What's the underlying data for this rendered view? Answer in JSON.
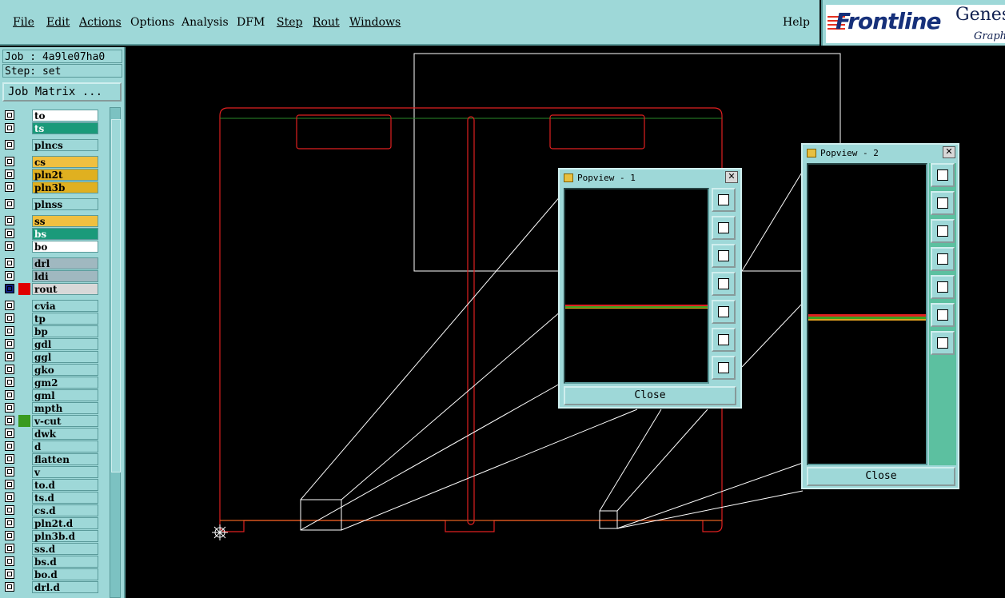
{
  "menu": [
    "File",
    "Edit",
    "Actions",
    "Options",
    "Analysis",
    "DFM",
    "Step",
    "Rout",
    "Windows"
  ],
  "help": "Help",
  "logo": {
    "brand": "Frontline",
    "product": "Genes",
    "sub": "Graph"
  },
  "job": {
    "job_label": "Job : 4a9le07ha0",
    "step_label": "Step: set",
    "matrix_button": "Job Matrix ..."
  },
  "layers": [
    {
      "name": "to",
      "color": "#ffffff",
      "mark": ""
    },
    {
      "name": "ts",
      "color": "#1a9a7a",
      "mark": ""
    },
    {
      "name": "plncs",
      "color": "#9ed8d8",
      "mark": ""
    },
    {
      "name": "cs",
      "color": "#f0c040",
      "mark": ""
    },
    {
      "name": "pln2t",
      "color": "#e0b020",
      "mark": ""
    },
    {
      "name": "pln3b",
      "color": "#e0b020",
      "mark": ""
    },
    {
      "name": "plnss",
      "color": "#9ed8d8",
      "mark": ""
    },
    {
      "name": "ss",
      "color": "#f0c040",
      "mark": ""
    },
    {
      "name": "bs",
      "color": "#1a9a7a",
      "mark": ""
    },
    {
      "name": "bo",
      "color": "#ffffff",
      "mark": ""
    },
    {
      "name": "drl",
      "color": "#a0b8c0",
      "mark": ""
    },
    {
      "name": "ldi",
      "color": "#a0b8c0",
      "mark": ""
    },
    {
      "name": "rout",
      "color": "#d8d8d8",
      "mark": "#e00000"
    },
    {
      "name": "cvia",
      "color": "#9ed8d8",
      "mark": ""
    },
    {
      "name": "tp",
      "color": "#9ed8d8",
      "mark": ""
    },
    {
      "name": "bp",
      "color": "#9ed8d8",
      "mark": ""
    },
    {
      "name": "gdl",
      "color": "#9ed8d8",
      "mark": ""
    },
    {
      "name": "ggl",
      "color": "#9ed8d8",
      "mark": ""
    },
    {
      "name": "gko",
      "color": "#9ed8d8",
      "mark": ""
    },
    {
      "name": "gm2",
      "color": "#9ed8d8",
      "mark": ""
    },
    {
      "name": "gml",
      "color": "#9ed8d8",
      "mark": ""
    },
    {
      "name": "mpth",
      "color": "#9ed8d8",
      "mark": ""
    },
    {
      "name": "v-cut",
      "color": "#9ed8d8",
      "mark": "#3a9a20"
    },
    {
      "name": "dwk",
      "color": "#9ed8d8",
      "mark": ""
    },
    {
      "name": "d",
      "color": "#9ed8d8",
      "mark": ""
    },
    {
      "name": "flatten",
      "color": "#9ed8d8",
      "mark": ""
    },
    {
      "name": "v",
      "color": "#9ed8d8",
      "mark": ""
    },
    {
      "name": "to.d",
      "color": "#9ed8d8",
      "mark": ""
    },
    {
      "name": "ts.d",
      "color": "#9ed8d8",
      "mark": ""
    },
    {
      "name": "cs.d",
      "color": "#9ed8d8",
      "mark": ""
    },
    {
      "name": "pln2t.d",
      "color": "#9ed8d8",
      "mark": ""
    },
    {
      "name": "pln3b.d",
      "color": "#9ed8d8",
      "mark": ""
    },
    {
      "name": "ss.d",
      "color": "#9ed8d8",
      "mark": ""
    },
    {
      "name": "bs.d",
      "color": "#9ed8d8",
      "mark": ""
    },
    {
      "name": "bo.d",
      "color": "#9ed8d8",
      "mark": ""
    },
    {
      "name": "drl.d",
      "color": "#9ed8d8",
      "mark": ""
    }
  ],
  "popview1": {
    "title": "Popview - 1",
    "close": "Close"
  },
  "popview2": {
    "title": "Popview - 2",
    "close": "Close"
  }
}
